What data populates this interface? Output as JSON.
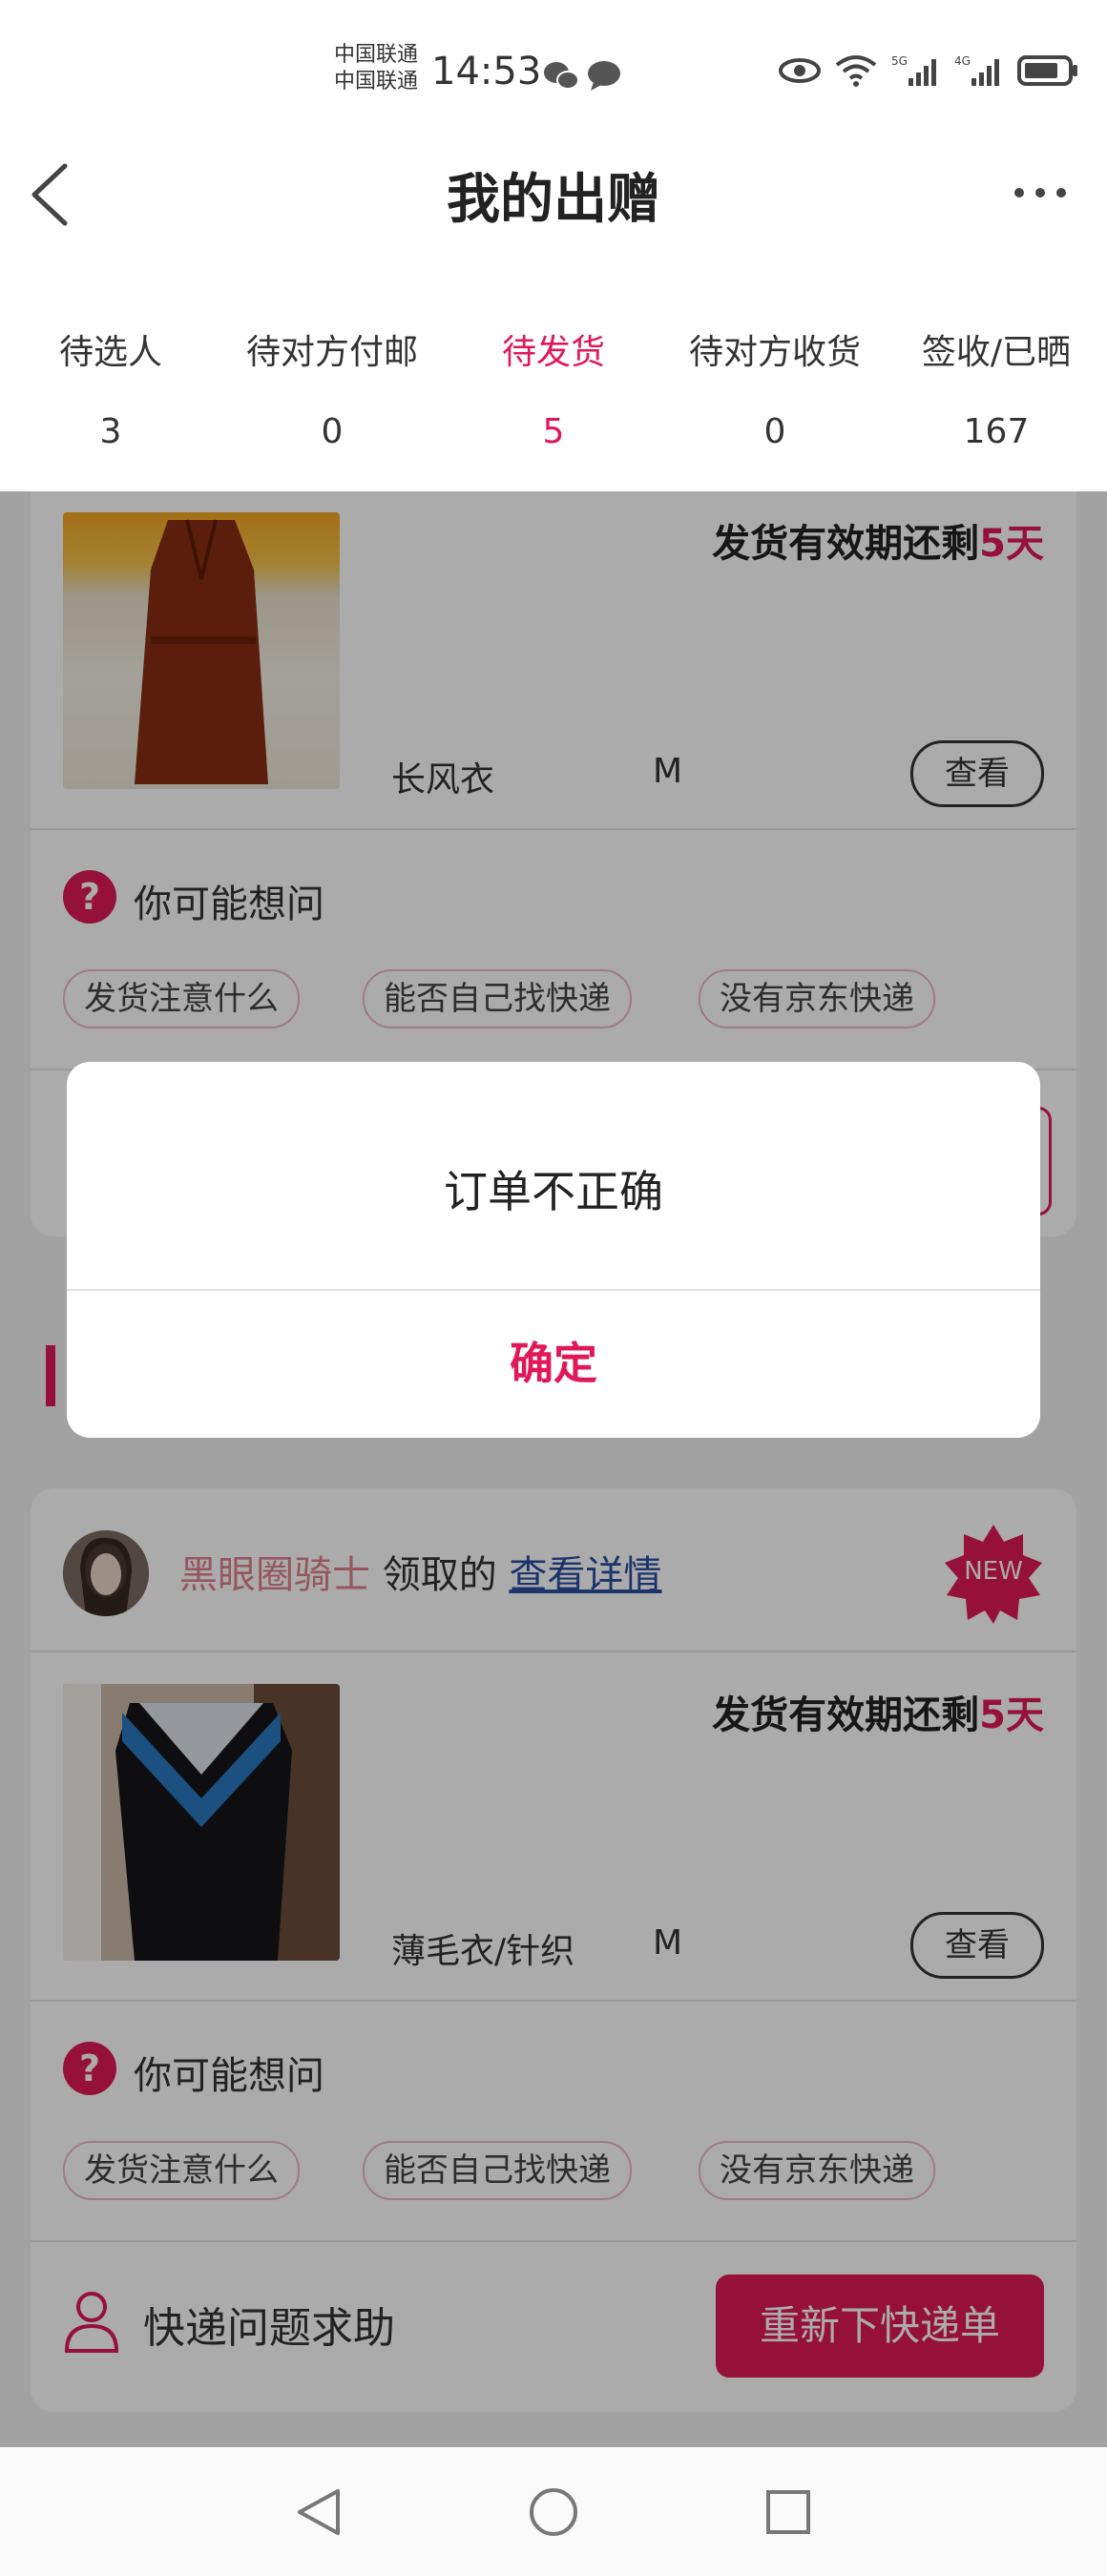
{
  "status_bar": {
    "carrier_1": "中国联通",
    "carrier_2": "中国联通",
    "time": "14:53",
    "icons": [
      "wechat-icon",
      "message-icon",
      "eye-icon",
      "wifi-icon",
      "signal-5g-icon",
      "signal-4g-icon",
      "battery-icon"
    ]
  },
  "header": {
    "title": "我的出赠",
    "back_icon": "back-arrow-icon",
    "more_icon": "more-dots-icon"
  },
  "tabs": [
    {
      "label": "待选人",
      "count": "3",
      "active": false
    },
    {
      "label": "待对方付邮",
      "count": "0",
      "active": false
    },
    {
      "label": "待发货",
      "count": "5",
      "active": true
    },
    {
      "label": "待对方收货",
      "count": "0",
      "active": false
    },
    {
      "label": "签收/已晒",
      "count": "167",
      "active": false
    }
  ],
  "orders": [
    {
      "deadline_prefix": "发货有效期还剩",
      "deadline_value": "5天",
      "item_name": "长风衣",
      "size": "M",
      "view_label": "查看",
      "question_title": "你可能想问",
      "chips": [
        "发货注意什么",
        "能否自己找快递",
        "没有京东快递"
      ]
    },
    {
      "receiver": "黑眼圈骑士",
      "received_text": "领取的",
      "detail_link": "查看详情",
      "new_badge": "NEW",
      "deadline_prefix": "发货有效期还剩",
      "deadline_value": "5天",
      "item_name": "薄毛衣/针织",
      "size": "M",
      "view_label": "查看",
      "question_title": "你可能想问",
      "chips": [
        "发货注意什么",
        "能否自己找快递",
        "没有京东快递"
      ],
      "help_label": "快递问题求助",
      "reorder_label": "重新下快递单"
    }
  ],
  "dialog": {
    "message": "订单不正确",
    "confirm": "确定"
  },
  "colors": {
    "accent": "#e0185a",
    "overlay": "rgba(0,0,0,0.33)"
  }
}
